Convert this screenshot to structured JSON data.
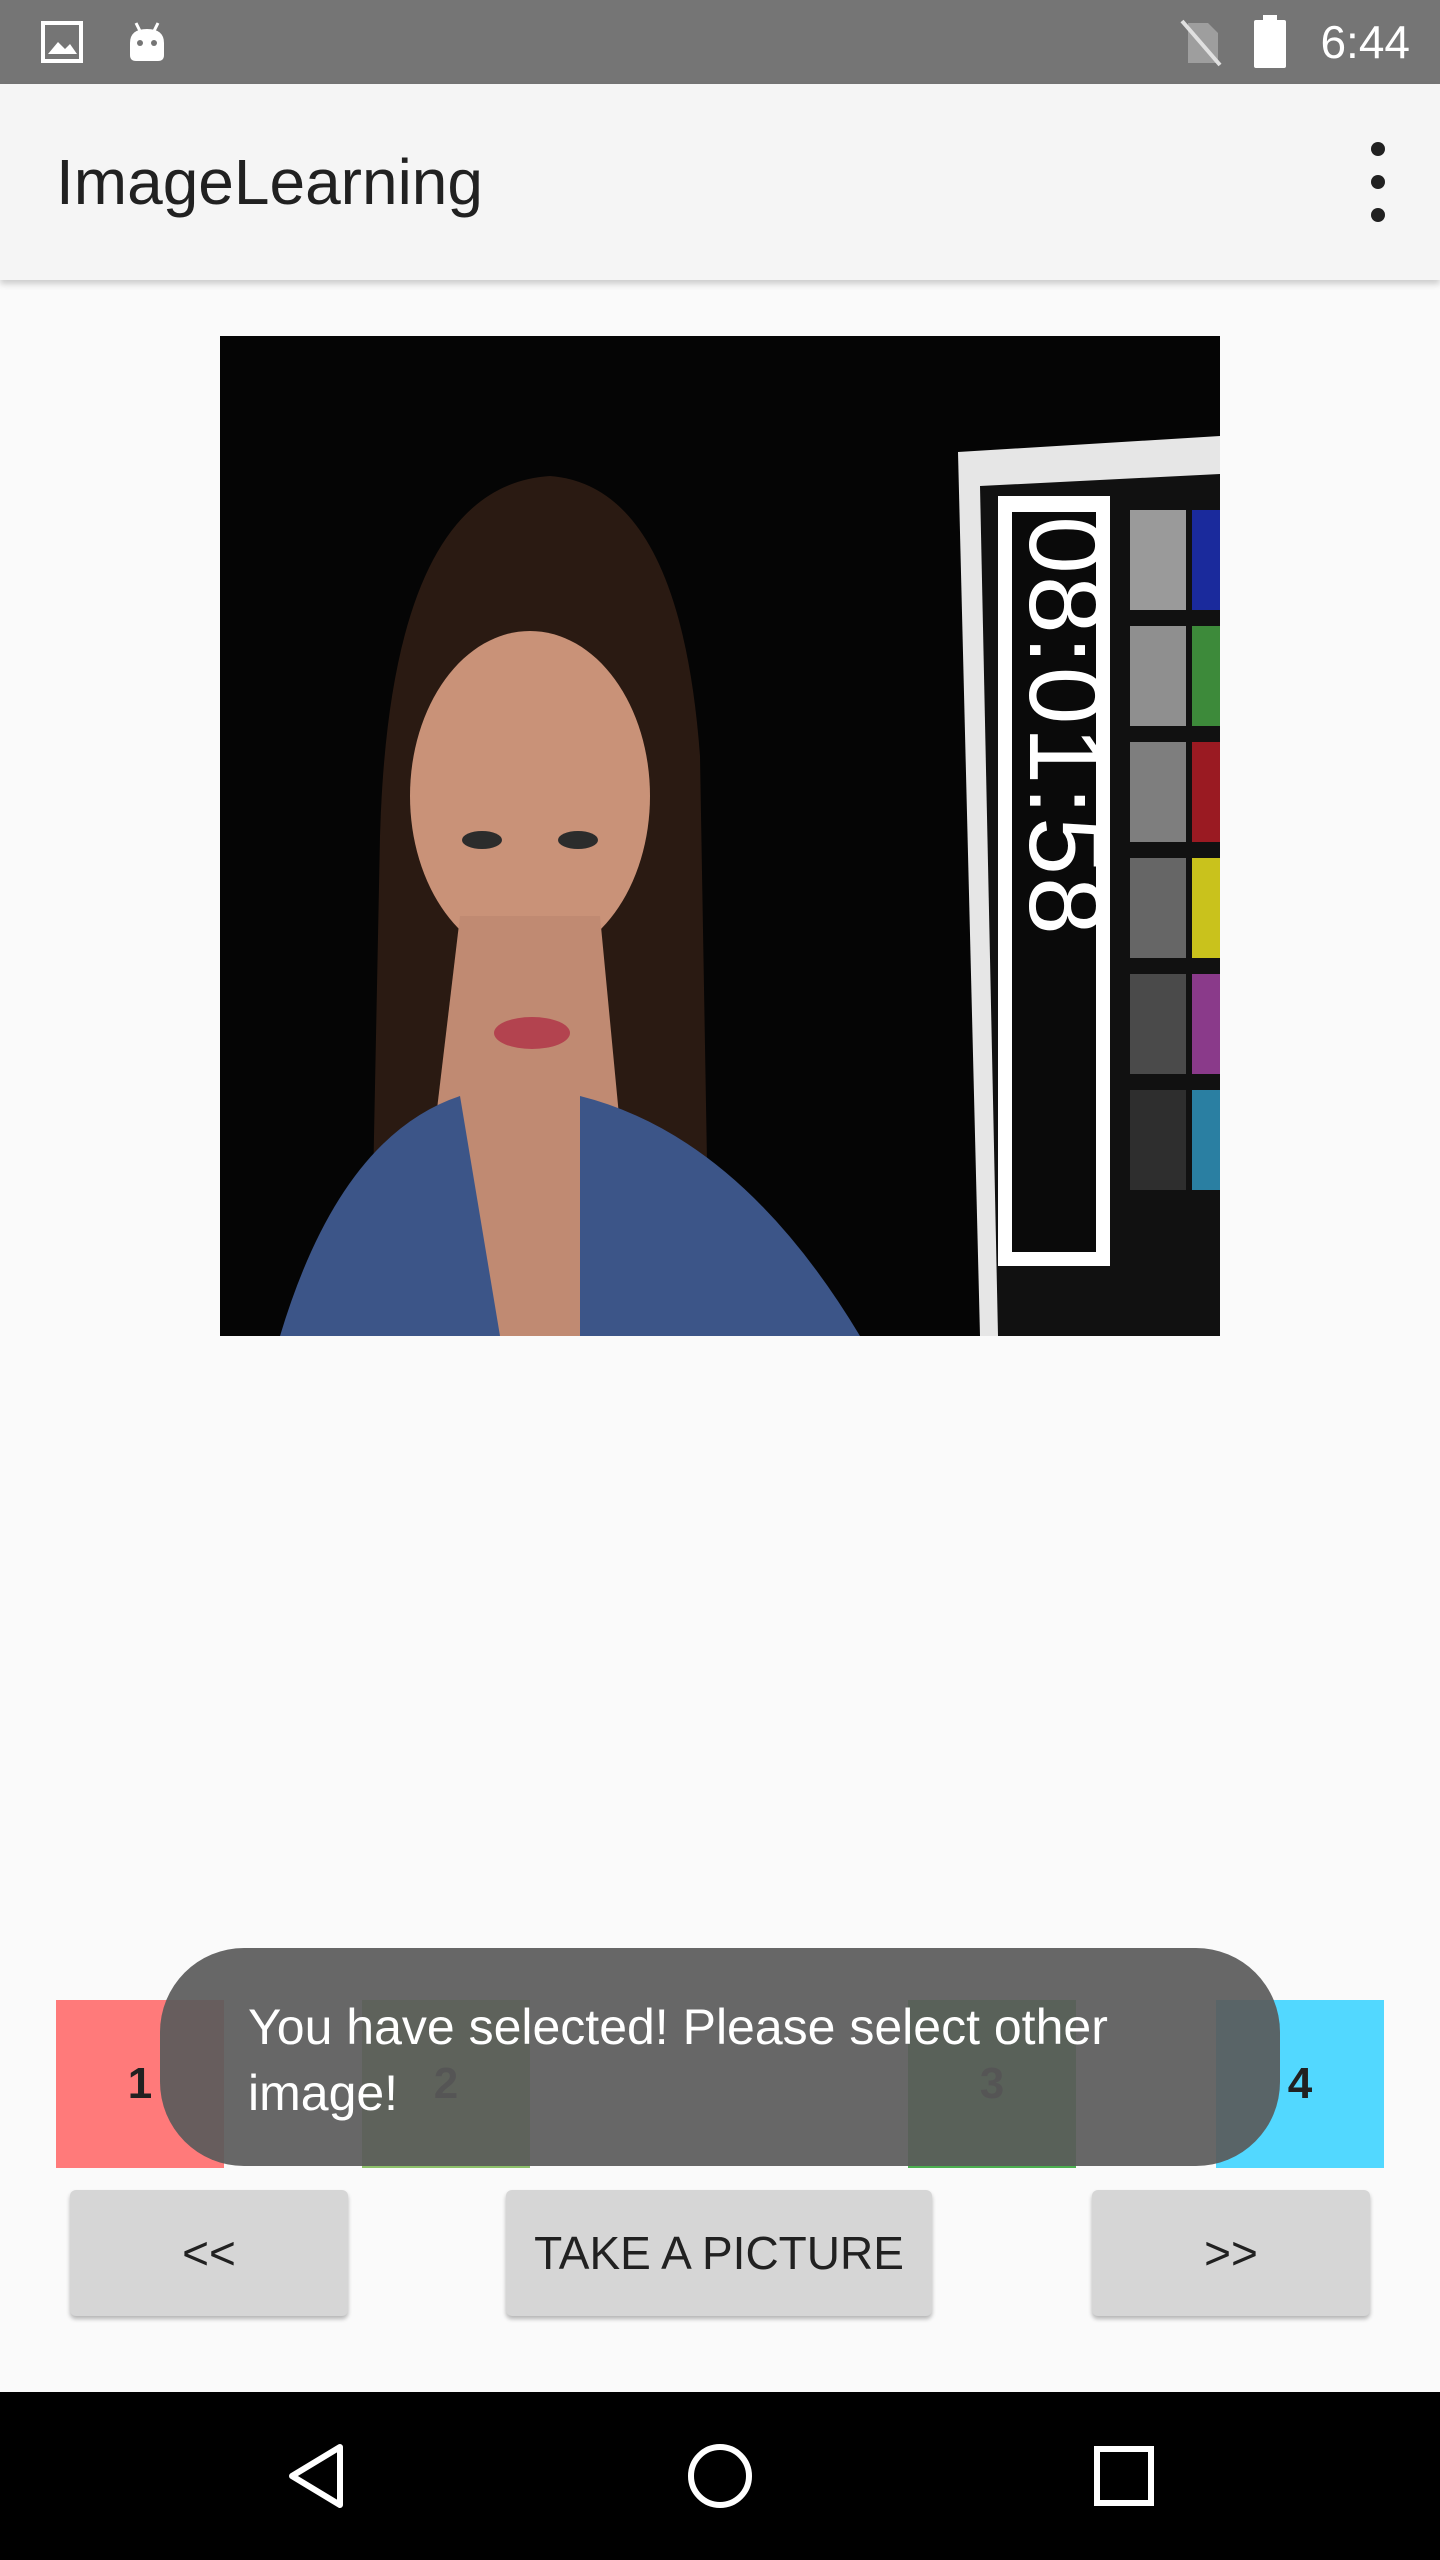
{
  "status_bar": {
    "time": "6:44",
    "icons": [
      "image-icon",
      "android-icon",
      "no-sim-icon",
      "battery-icon"
    ]
  },
  "app_bar": {
    "title": "ImageLearning",
    "menu_icon": "more-vert-icon"
  },
  "photo": {
    "description_icon": "face-photo",
    "clock_text": "08:01:58"
  },
  "tiles": [
    {
      "label": "1",
      "color": "#ff7a7a"
    },
    {
      "label": "2",
      "color": "#8dc16a"
    },
    {
      "label": "3",
      "color": "#4caf50"
    },
    {
      "label": "4",
      "color": "#52d8ff"
    }
  ],
  "buttons": {
    "prev": "<<",
    "take": "TAKE A PICTURE",
    "next": ">>"
  },
  "toast": {
    "message": "You have selected! Please select other image!"
  },
  "nav_bar": {
    "icons": [
      "back-icon",
      "home-icon",
      "recents-icon"
    ]
  }
}
